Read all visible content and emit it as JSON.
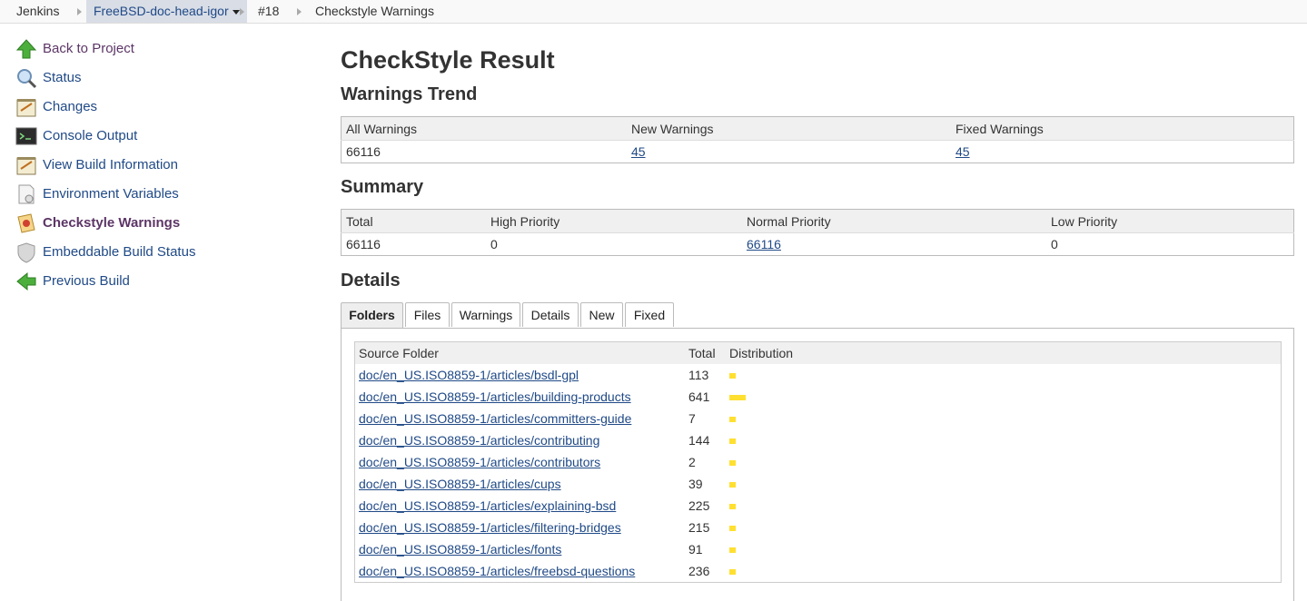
{
  "breadcrumb": {
    "items": [
      {
        "label": "Jenkins"
      },
      {
        "label": "FreeBSD-doc-head-igor"
      },
      {
        "label": "#18"
      },
      {
        "label": "Checkstyle Warnings"
      }
    ]
  },
  "sidebar": {
    "items": [
      {
        "label": "Back to Project",
        "icon": "up-arrow-icon"
      },
      {
        "label": "Status",
        "icon": "magnifier-icon"
      },
      {
        "label": "Changes",
        "icon": "notepad-icon"
      },
      {
        "label": "Console Output",
        "icon": "terminal-icon"
      },
      {
        "label": "View Build Information",
        "icon": "notepad-icon"
      },
      {
        "label": "Environment Variables",
        "icon": "document-icon"
      },
      {
        "label": "Checkstyle Warnings",
        "icon": "checkstyle-icon"
      },
      {
        "label": "Embeddable Build Status",
        "icon": "shield-icon"
      },
      {
        "label": "Previous Build",
        "icon": "left-arrow-icon"
      }
    ]
  },
  "main": {
    "title": "CheckStyle Result",
    "trend": {
      "heading": "Warnings Trend",
      "headers": [
        "All Warnings",
        "New Warnings",
        "Fixed Warnings"
      ],
      "values": [
        "66116",
        "45",
        "45"
      ]
    },
    "summary": {
      "heading": "Summary",
      "headers": [
        "Total",
        "High Priority",
        "Normal Priority",
        "Low Priority"
      ],
      "values": [
        "66116",
        "0",
        "66116",
        "0"
      ]
    },
    "details": {
      "heading": "Details",
      "tabs": [
        "Folders",
        "Files",
        "Warnings",
        "Details",
        "New",
        "Fixed"
      ],
      "headers": [
        "Source Folder",
        "Total",
        "Distribution"
      ],
      "rows": [
        {
          "folder": "doc/en_US.ISO8859-1/articles/bsdl-gpl",
          "total": "113",
          "fraction": 0.176
        },
        {
          "folder": "doc/en_US.ISO8859-1/articles/building-products",
          "total": "641",
          "fraction": 1.0
        },
        {
          "folder": "doc/en_US.ISO8859-1/articles/committers-guide",
          "total": "7",
          "fraction": 0.011
        },
        {
          "folder": "doc/en_US.ISO8859-1/articles/contributing",
          "total": "144",
          "fraction": 0.225
        },
        {
          "folder": "doc/en_US.ISO8859-1/articles/contributors",
          "total": "2",
          "fraction": 0.003
        },
        {
          "folder": "doc/en_US.ISO8859-1/articles/cups",
          "total": "39",
          "fraction": 0.061
        },
        {
          "folder": "doc/en_US.ISO8859-1/articles/explaining-bsd",
          "total": "225",
          "fraction": 0.351
        },
        {
          "folder": "doc/en_US.ISO8859-1/articles/filtering-bridges",
          "total": "215",
          "fraction": 0.335
        },
        {
          "folder": "doc/en_US.ISO8859-1/articles/fonts",
          "total": "91",
          "fraction": 0.142
        },
        {
          "folder": "doc/en_US.ISO8859-1/articles/freebsd-questions",
          "total": "236",
          "fraction": 0.368
        }
      ]
    }
  },
  "colors": {
    "link": "#204a87",
    "visited": "#5c3566",
    "bar": "#ffe030"
  }
}
